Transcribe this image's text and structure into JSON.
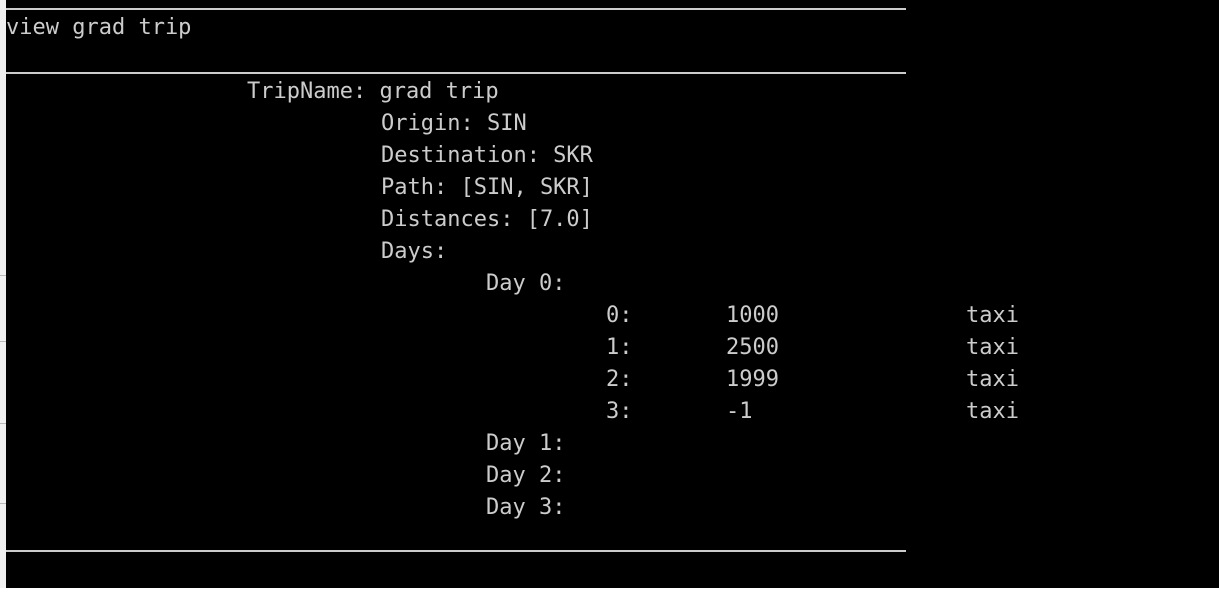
{
  "console": {
    "command": "view grad trip",
    "trip": {
      "name_line": "TripName: grad trip",
      "origin_line": "Origin: SIN",
      "destination_line": "Destination: SKR",
      "path_line": "Path: [SIN, SKR]",
      "distances_line": "Distances: [7.0]",
      "days_label": "Days:",
      "days": [
        {
          "label": "Day 0:",
          "entries": [
            {
              "index": "0:",
              "amount": "1000",
              "mode": "taxi"
            },
            {
              "index": "1:",
              "amount": "2500",
              "mode": "taxi"
            },
            {
              "index": "2:",
              "amount": "1999",
              "mode": "taxi"
            },
            {
              "index": "3:",
              "amount": "-1",
              "mode": "taxi"
            }
          ]
        },
        {
          "label": "Day 1:",
          "entries": []
        },
        {
          "label": "Day 2:",
          "entries": []
        },
        {
          "label": "Day 3:",
          "entries": []
        }
      ]
    },
    "colors": {
      "background": "#000000",
      "text": "#cccccc"
    }
  }
}
